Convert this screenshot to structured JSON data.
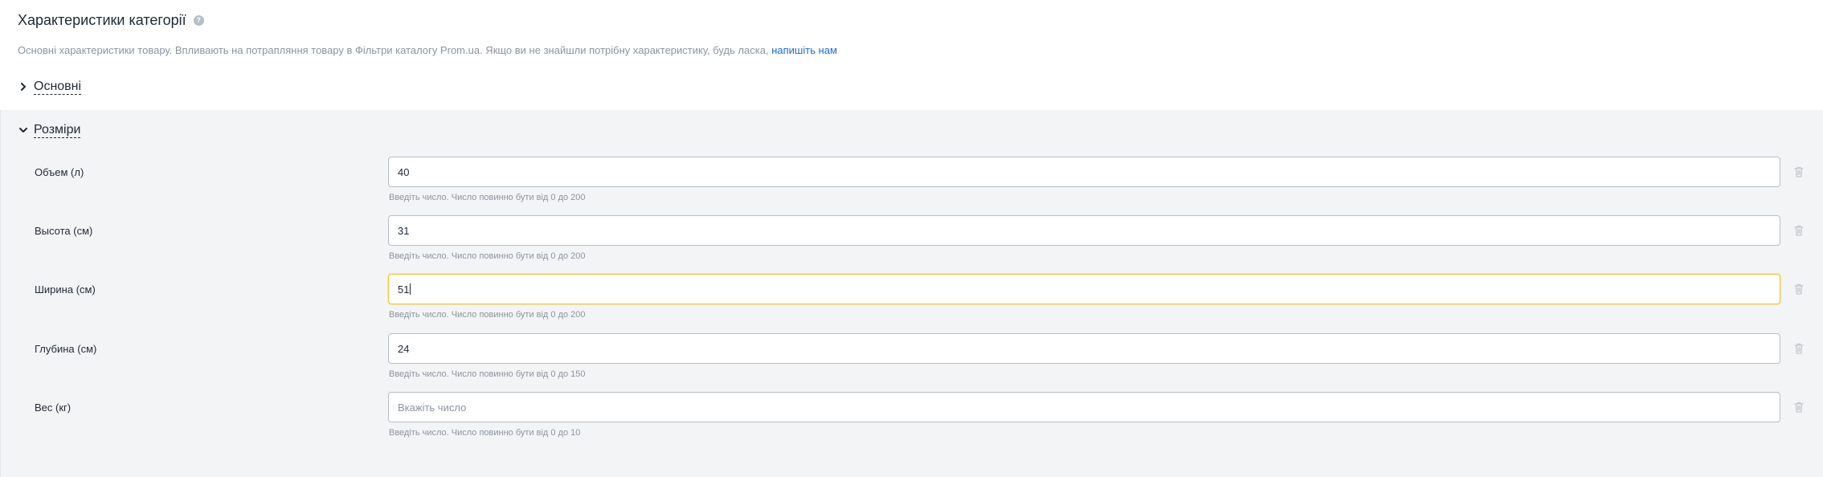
{
  "header": {
    "title": "Характеристики категорії",
    "help_icon": "?"
  },
  "description": {
    "text": "Основні характеристики товару. Впливають на потрапляння товару в Фільтри каталогу Prom.ua. Якщо ви не знайшли потрібну характеристику, будь ласка, ",
    "link_label": "напишіть нам"
  },
  "sections": {
    "main": {
      "label": "Основні",
      "expanded": false
    },
    "sizes": {
      "label": "Розміри",
      "expanded": true
    }
  },
  "fields": [
    {
      "label": "Объем (л)",
      "value": "40",
      "placeholder": "",
      "hint": "Введіть число. Число повинно бути від 0 до 200"
    },
    {
      "label": "Высота (см)",
      "value": "31",
      "placeholder": "",
      "hint": "Введіть число. Число повинно бути від 0 до 200"
    },
    {
      "label": "Ширина (см)",
      "value": "51",
      "placeholder": "",
      "hint": "Введіть число. Число повинно бути від 0 до 200"
    },
    {
      "label": "Глубина (см)",
      "value": "24",
      "placeholder": "",
      "hint": "Введіть число. Число повинно бути від 0 до 150"
    },
    {
      "label": "Вес (кг)",
      "value": "",
      "placeholder": "Вкажіть число",
      "hint": "Введіть число. Число повинно бути від 0 до 10"
    }
  ],
  "colors": {
    "link": "#1a6fd6",
    "focus_border": "#f2c230",
    "panel_bg": "#f3f4f6",
    "hint_text": "#8d949e"
  }
}
